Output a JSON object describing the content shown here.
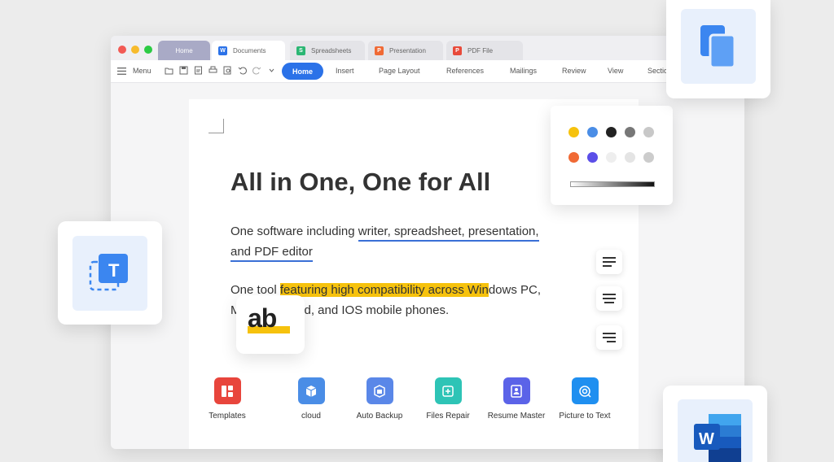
{
  "window": {
    "tabs": [
      {
        "label": "Home",
        "icon": "none"
      },
      {
        "label": "Documents",
        "icon": "W",
        "color": "#2b72e8"
      },
      {
        "label": "Spreadsheets",
        "icon": "S",
        "color": "#2bb673"
      },
      {
        "label": "Presentation",
        "icon": "P",
        "color": "#f06a35"
      },
      {
        "label": "PDF File",
        "icon": "P",
        "color": "#e84a3a"
      }
    ],
    "traffic_colors": [
      "#f25a55",
      "#f7bb2d",
      "#2ccb45"
    ]
  },
  "toolbar": {
    "menu_label": "Menu",
    "ribbon_tabs": [
      "Home",
      "Insert",
      "Page Layout",
      "References",
      "Mailings",
      "Review",
      "View",
      "Sectio"
    ]
  },
  "document": {
    "title": "All in One, One for All",
    "para1_plain": "One software including ",
    "para1_ul1": "writer, spreadsheet, presentation,",
    "para1_ul2": "and PDF editor",
    "para2_plain": "One tool ",
    "para2_hl": "featuring high compatibility across Win",
    "para2_rest": "dows PC,",
    "para2_line2_a": "M",
    "para2_line2_b": "d, and IOS mobile phones."
  },
  "apps": [
    {
      "label": "Templates",
      "color": "#e8453c",
      "icon": "templates-icon"
    },
    {
      "label": "cloud",
      "color": "#4a8de6",
      "icon": "cloud-box-icon"
    },
    {
      "label": "Auto Backup",
      "color": "#5a87e8",
      "icon": "backup-icon"
    },
    {
      "label": "Files Repair",
      "color": "#2ec4b6",
      "icon": "repair-icon"
    },
    {
      "label": "Resume Master",
      "color": "#5b63e8",
      "icon": "resume-icon"
    },
    {
      "label": "Picture to Text",
      "color": "#1f8ff0",
      "icon": "ocr-icon"
    }
  ],
  "palette": {
    "row1": [
      "#f6c20d",
      "#4a8de6",
      "#222222",
      "#777777",
      "#c8c8c8"
    ],
    "row2": [
      "#f06a35",
      "#5b4ee8",
      "#eeeeee",
      "#e4e4e4",
      "#cccccc"
    ]
  },
  "badges": {
    "ab_text": "ab",
    "text_tool_letter": "T",
    "word_letter": "W"
  },
  "colors": {
    "accent": "#2b72e8",
    "highlight": "#f6c20d"
  }
}
